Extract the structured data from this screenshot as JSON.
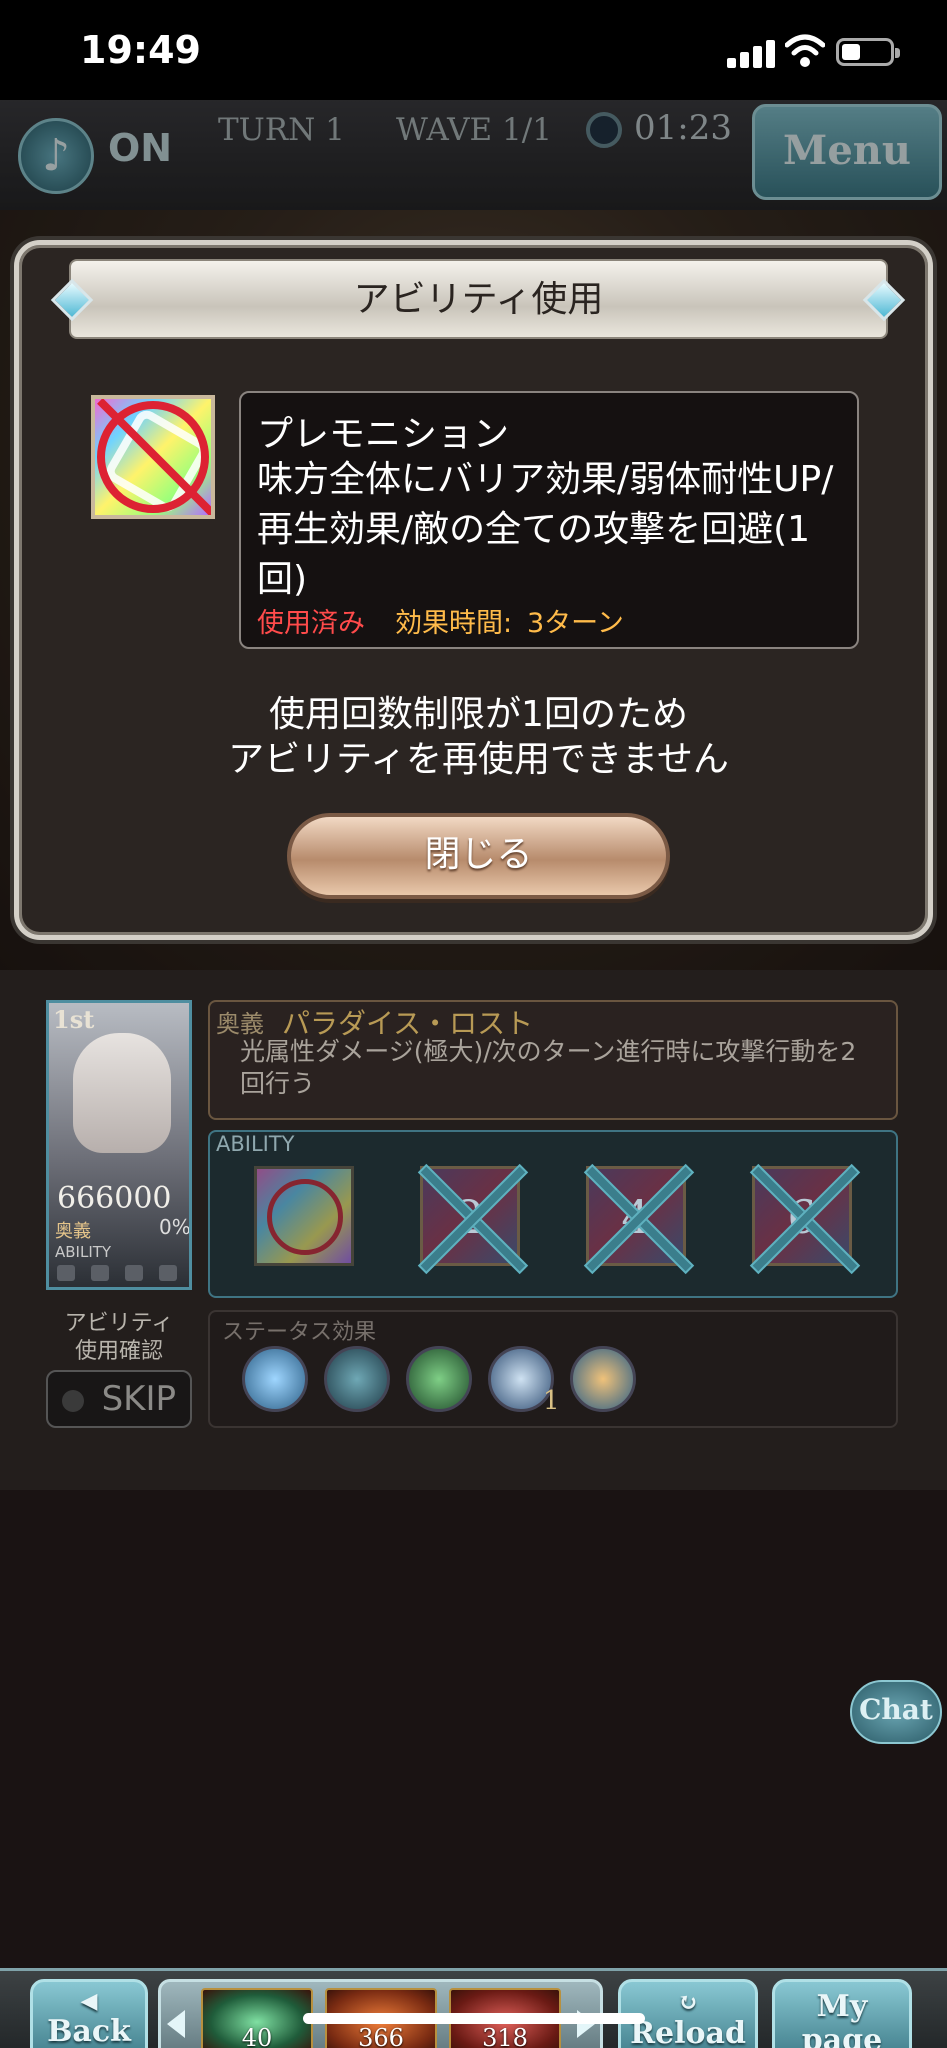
{
  "status_bar": {
    "time": "19:49"
  },
  "header": {
    "music_label": "ON",
    "turn": "TURN 1",
    "wave": "WAVE 1/1",
    "timer": "01:23",
    "menu_label": "Menu"
  },
  "dialog": {
    "title": "アビリティ使用",
    "ability_name": "プレモニション",
    "ability_description": "味方全体にバリア効果/弱体耐性UP/再生効果/敵の全ての攻撃を回避(1回)",
    "used_label": "使用済み",
    "duration_label": "効果時間:",
    "duration_value": "3ターン",
    "message_line1": "使用回数制限が1回のため",
    "message_line2": "アビリティを再使用できません",
    "close_label": "閉じる"
  },
  "character": {
    "rank": "1st",
    "hp": "666000",
    "ougi_label": "奥義",
    "ougi_percent": "0%",
    "ability_label": "ABILITY"
  },
  "ougi": {
    "tag": "奥義",
    "name": "パラダイス・ロスト",
    "description": "光属性ダメージ(極大)/次のターン進行時に攻撃行動を2回行う"
  },
  "abilities": {
    "label": "ABILITY",
    "slots": [
      {
        "icon": "rainbow-barrier-icon",
        "number": ""
      },
      {
        "icon": "ability-icon",
        "number": "2"
      },
      {
        "icon": "ability-icon",
        "number": "4"
      },
      {
        "icon": "ability-icon",
        "number": "6"
      }
    ]
  },
  "skip": {
    "confirm_label": "アビリティ\n使用確認",
    "label": "SKIP"
  },
  "status_effects": {
    "label": "ステータス効果",
    "icons": [
      "barrier-icon",
      "book-icon",
      "sparkle-icon",
      "dodge-icon",
      "debuff-resist-icon"
    ],
    "dodge_count": "1"
  },
  "chat_label": "Chat",
  "bottom_bar": {
    "back_label": "Back",
    "reload_label": "Reload",
    "mypage_label": "My page",
    "items": [
      {
        "name": "green-potion-icon",
        "count": "40"
      },
      {
        "name": "full-elixir-icon",
        "count": "366"
      },
      {
        "name": "soul-berry-icon",
        "count": "318"
      }
    ]
  },
  "colors": {
    "accent_teal": "#82c1cd",
    "used_red": "#ff4b4b",
    "duration_orange": "#ffbb4a",
    "ougi_gold": "#b89a55"
  }
}
